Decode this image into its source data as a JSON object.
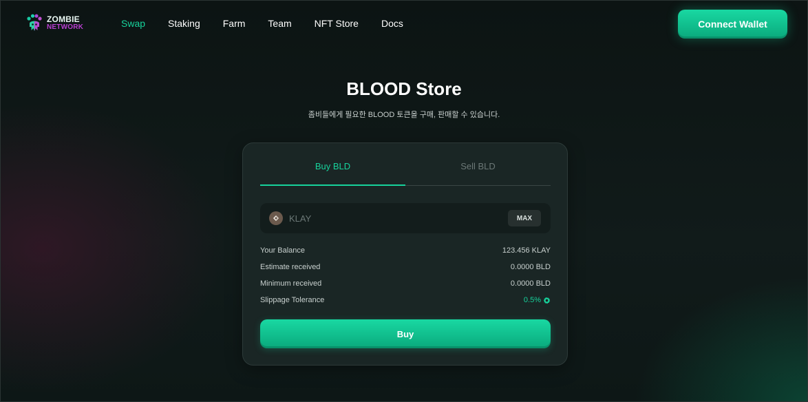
{
  "brand": {
    "line1": "ZOMBIE",
    "line2": "NETWORK",
    "accent_color": "#17d39c",
    "logo_secondary_color": "#b83fd1",
    "logo_icon": "zombie-paw-icon"
  },
  "nav": {
    "items": [
      {
        "label": "Swap",
        "active": true
      },
      {
        "label": "Staking",
        "active": false
      },
      {
        "label": "Farm",
        "active": false
      },
      {
        "label": "Team",
        "active": false
      },
      {
        "label": "NFT Store",
        "active": false
      },
      {
        "label": "Docs",
        "active": false
      }
    ]
  },
  "header": {
    "connect_label": "Connect Wallet"
  },
  "page": {
    "title": "BLOOD Store",
    "subtitle": "좀비들에게 필요한 BLOOD 토큰을 구매, 판매할 수 있습니다."
  },
  "store": {
    "tabs": [
      {
        "label": "Buy BLD",
        "active": true
      },
      {
        "label": "Sell BLD",
        "active": false
      }
    ],
    "input": {
      "token_icon": "klay-token-icon",
      "placeholder": "KLAY",
      "value": "",
      "max_label": "MAX"
    },
    "info": [
      {
        "label": "Your Balance",
        "value": "123.456 KLAY"
      },
      {
        "label": "Estimate received",
        "value": "0.0000 BLD"
      },
      {
        "label": "Minimum received",
        "value": "0.0000 BLD"
      }
    ],
    "slippage": {
      "label": "Slippage Tolerance",
      "value": "0.5%",
      "icon": "gear-icon"
    },
    "buy_label": "Buy"
  }
}
